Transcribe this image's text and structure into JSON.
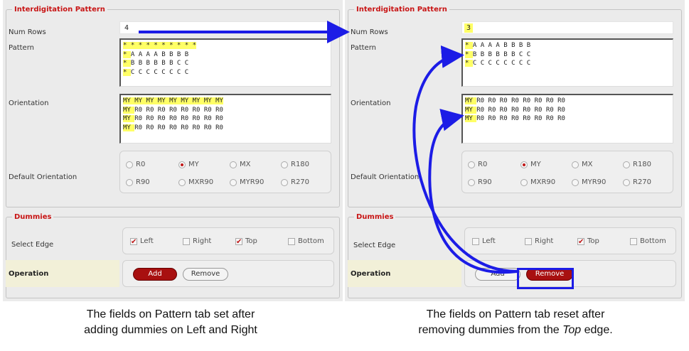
{
  "left": {
    "interdig_legend": "Interdigitation Pattern",
    "num_rows_label": "Num Rows",
    "num_rows_value": "4",
    "pattern_label": "Pattern",
    "pattern_lines": [
      "* * * * * * * * * *",
      "* A A A A B B B B",
      "* B B B B B B C C",
      "* C C C C C C C C"
    ],
    "orientation_label": "Orientation",
    "orientation_lines": [
      "MY MY MY MY MY MY MY MY MY",
      "MY R0 R0 R0 R0 R0 R0 R0 R0",
      "MY R0 R0 R0 R0 R0 R0 R0 R0",
      "MY R0 R0 R0 R0 R0 R0 R0 R0"
    ],
    "default_orientation_label": "Default Orientation",
    "orient_options": [
      "R0",
      "MY",
      "MX",
      "R180",
      "R90",
      "MXR90",
      "MYR90",
      "R270"
    ],
    "orient_selected": "MY",
    "dummies_legend": "Dummies",
    "select_edge_label": "Select Edge",
    "edges": [
      {
        "label": "Left",
        "checked": true
      },
      {
        "label": "Right",
        "checked": false
      },
      {
        "label": "Top",
        "checked": true
      },
      {
        "label": "Bottom",
        "checked": false
      }
    ],
    "operation_label": "Operation",
    "add_label": "Add",
    "remove_label": "Remove"
  },
  "right": {
    "interdig_legend": "Interdigitation Pattern",
    "num_rows_label": "Num Rows",
    "num_rows_value": "3",
    "pattern_label": "Pattern",
    "pattern_lines": [
      "* A A A A B B B B",
      "* B B B B B B C C",
      "* C C C C C C C C"
    ],
    "orientation_label": "Orientation",
    "orientation_lines": [
      "MY R0 R0 R0 R0 R0 R0 R0 R0",
      "MY R0 R0 R0 R0 R0 R0 R0 R0",
      "MY R0 R0 R0 R0 R0 R0 R0 R0"
    ],
    "default_orientation_label": "Default Orientation",
    "orient_options": [
      "R0",
      "MY",
      "MX",
      "R180",
      "R90",
      "MXR90",
      "MYR90",
      "R270"
    ],
    "orient_selected": "MY",
    "dummies_legend": "Dummies",
    "select_edge_label": "Select Edge",
    "edges": [
      {
        "label": "Left",
        "checked": false
      },
      {
        "label": "Right",
        "checked": false
      },
      {
        "label": "Top",
        "checked": true
      },
      {
        "label": "Bottom",
        "checked": false
      }
    ],
    "operation_label": "Operation",
    "add_label": "Add",
    "remove_label": "Remove"
  },
  "captions": {
    "left_line1": "The fields on Pattern tab set after",
    "left_line2": "adding dummies on Left and Right",
    "right_line1": "The fields on Pattern tab reset after",
    "right_line2_a": "removing dummies from the ",
    "right_line2_b": "Top",
    "right_line2_c": " edge."
  },
  "colors": {
    "accent_red": "#c81414",
    "highlight": "#ffff66",
    "arrow_blue": "#1c1ce6"
  }
}
